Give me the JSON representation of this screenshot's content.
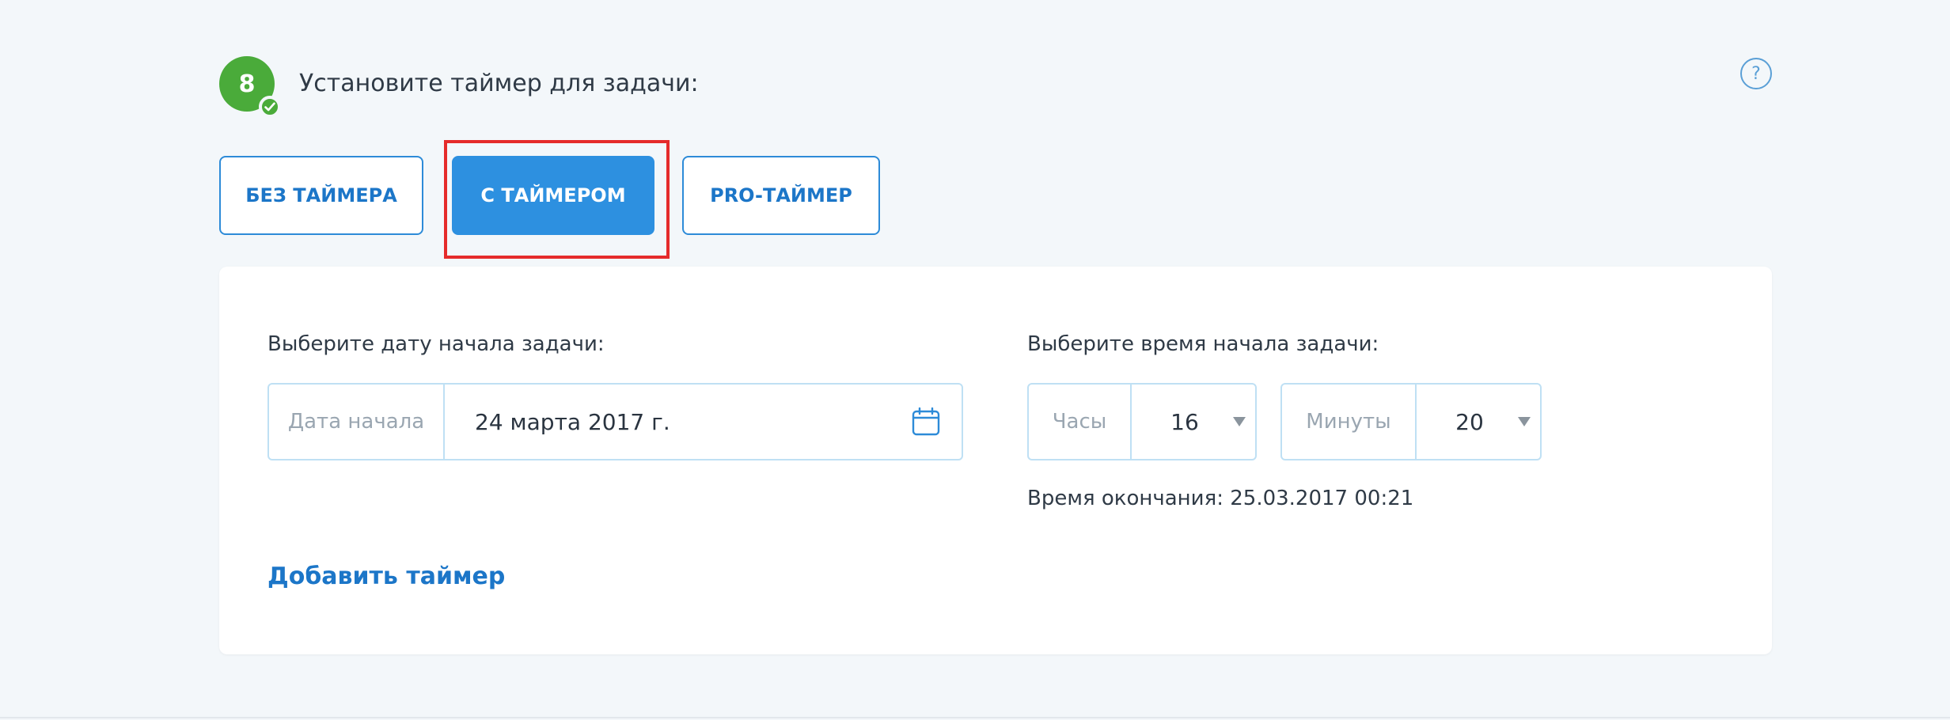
{
  "step": {
    "number": "8",
    "title": "Установите таймер для задачи:",
    "help_label": "?"
  },
  "modes": [
    {
      "label": "БЕЗ ТАЙМЕРА",
      "active": false
    },
    {
      "label": "С ТАЙМЕРОМ",
      "active": true
    },
    {
      "label": "PRO-ТАЙМЕР",
      "active": false
    }
  ],
  "date": {
    "label": "Выберите дату начала задачи:",
    "addon": "Дата начала",
    "value": "24 марта 2017 г."
  },
  "time": {
    "label": "Выберите время начала задачи:",
    "hours_addon": "Часы",
    "hours_value": "16",
    "minutes_addon": "Минуты",
    "minutes_value": "20"
  },
  "end_time": "Время окончания: 25.03.2017 00:21",
  "add_timer_label": "Добавить таймер",
  "colors": {
    "accent": "#2d90e0",
    "success": "#4aab3a",
    "highlight": "#e52b2b"
  }
}
